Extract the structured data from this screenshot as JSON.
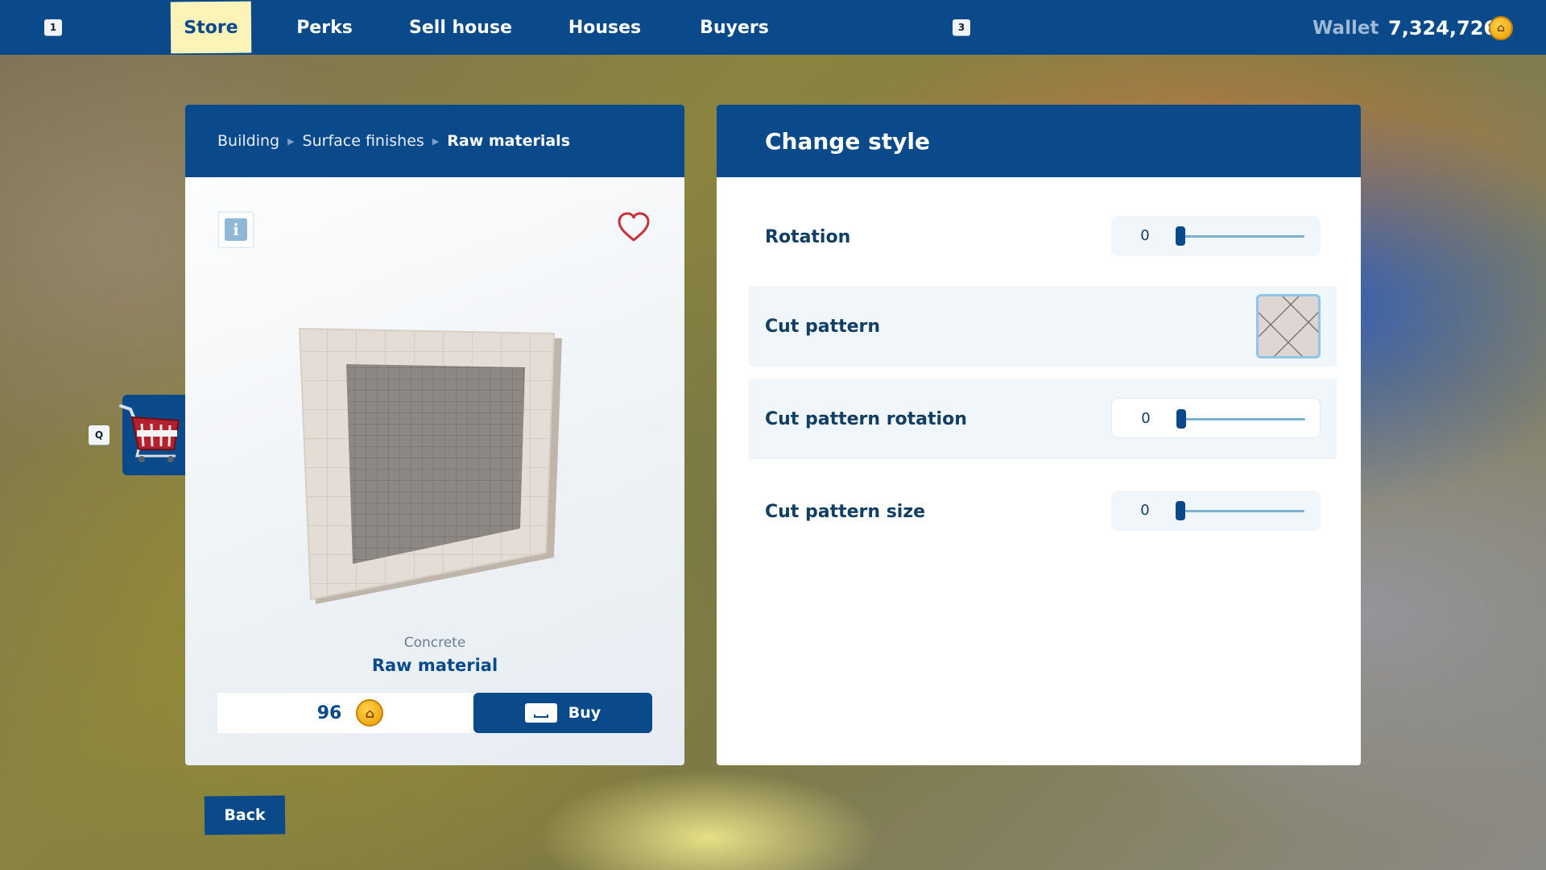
{
  "topbar": {
    "left_key": "1",
    "right_key": "3",
    "tabs": [
      {
        "label": "Store",
        "active": true
      },
      {
        "label": "Perks",
        "active": false
      },
      {
        "label": "Sell house",
        "active": false
      },
      {
        "label": "Houses",
        "active": false
      },
      {
        "label": "Buyers",
        "active": false
      }
    ],
    "wallet_label": "Wallet",
    "wallet_value": "7,324,726",
    "currency_icon": "house-coin-icon"
  },
  "product": {
    "breadcrumb": [
      "Building",
      "Surface finishes",
      "Raw materials"
    ],
    "info_icon": "info-icon",
    "favorite_icon": "heart-outline-icon",
    "subtitle": "Concrete",
    "name": "Raw material",
    "price": "96",
    "buy_label": "Buy",
    "buy_key_icon": "spacebar-icon"
  },
  "cart": {
    "key": "Q",
    "icon": "shopping-cart-icon"
  },
  "style_panel": {
    "title": "Change style",
    "rows": [
      {
        "label": "Rotation",
        "type": "slider",
        "value": "0",
        "level": 0
      },
      {
        "label": "Cut pattern",
        "type": "swatch"
      },
      {
        "label": "Cut pattern rotation",
        "type": "slider",
        "value": "0",
        "level": 0
      },
      {
        "label": "Cut pattern size",
        "type": "slider",
        "value": "0",
        "level": 0
      }
    ]
  },
  "back_label": "Back",
  "colors": {
    "brand_blue": "#0b4a8a",
    "active_tab": "#fbf3b8",
    "coin_gold": "#ffc21a",
    "heart_red": "#c4323a"
  }
}
